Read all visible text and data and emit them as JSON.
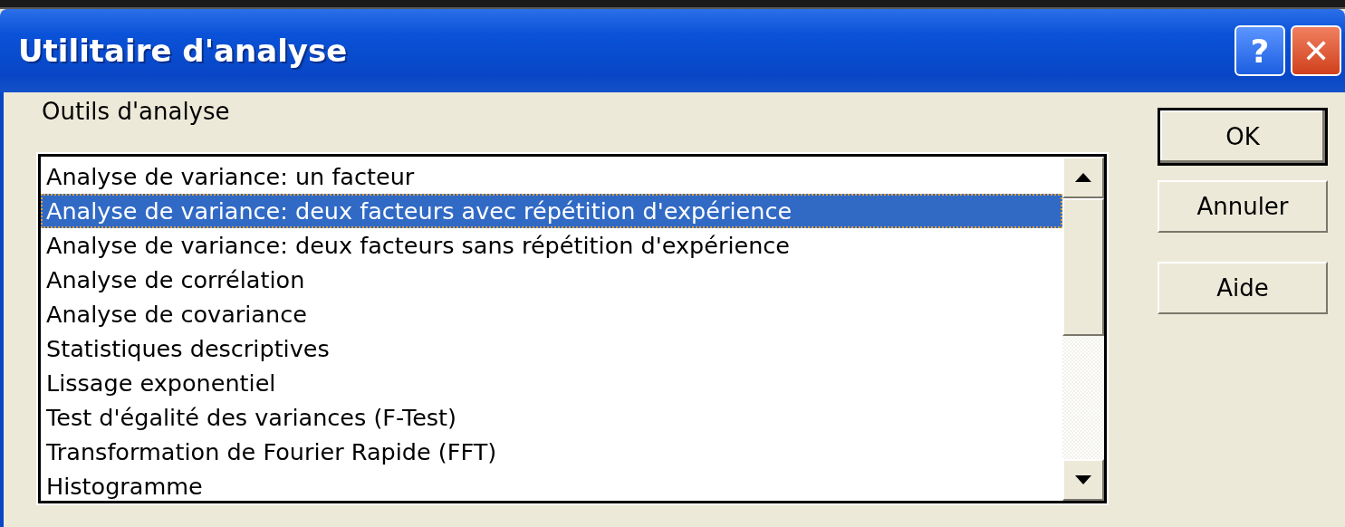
{
  "window": {
    "title": "Utilitaire d'analyse",
    "title_buttons": [
      {
        "kind": "help",
        "label": "?"
      },
      {
        "kind": "close",
        "label": "✕"
      }
    ]
  },
  "list_label": {
    "text": "Outils d'analyse"
  },
  "tools": [
    {
      "label": "Analyse de variance: un facteur",
      "selected": false
    },
    {
      "label": "Analyse de variance: deux facteurs avec répétition d'expérience",
      "selected": true
    },
    {
      "label": "Analyse de variance: deux facteurs sans répétition d'expérience",
      "selected": false
    },
    {
      "label": "Analyse de corrélation",
      "selected": false
    },
    {
      "label": "Analyse de covariance",
      "selected": false
    },
    {
      "label": "Statistiques descriptives",
      "selected": false
    },
    {
      "label": "Lissage exponentiel",
      "selected": false
    },
    {
      "label": "Test d'égalité des variances (F-Test)",
      "selected": false
    },
    {
      "label": "Transformation de Fourier Rapide (FFT)",
      "selected": false
    },
    {
      "label": "Histogramme",
      "selected": false
    }
  ],
  "buttons": [
    {
      "label": "OK",
      "default": true
    },
    {
      "label": "Annuler",
      "default": false
    },
    {
      "label": "Aide",
      "default": false
    }
  ]
}
